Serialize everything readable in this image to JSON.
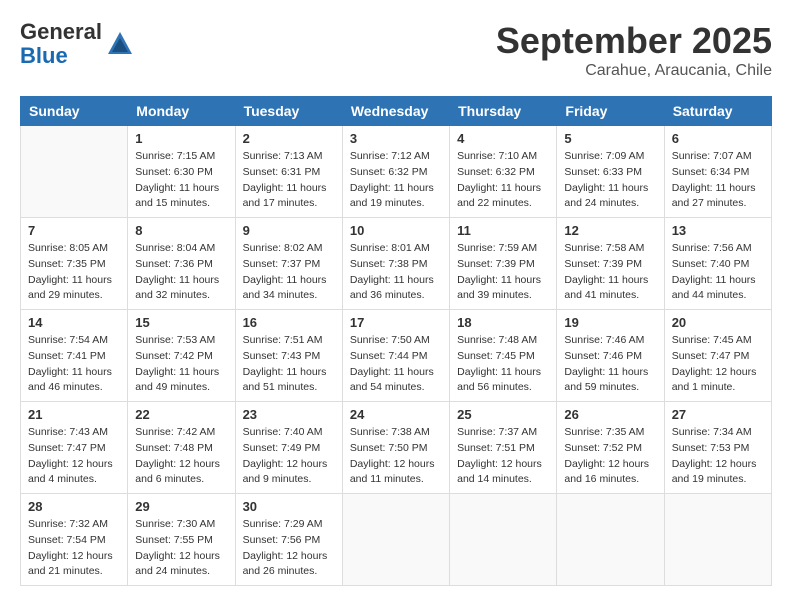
{
  "logo": {
    "general": "General",
    "blue": "Blue"
  },
  "title": {
    "month": "September 2025",
    "location": "Carahue, Araucania, Chile"
  },
  "weekdays": [
    "Sunday",
    "Monday",
    "Tuesday",
    "Wednesday",
    "Thursday",
    "Friday",
    "Saturday"
  ],
  "weeks": [
    [
      {
        "day": "",
        "info": ""
      },
      {
        "day": "1",
        "info": "Sunrise: 7:15 AM\nSunset: 6:30 PM\nDaylight: 11 hours\nand 15 minutes."
      },
      {
        "day": "2",
        "info": "Sunrise: 7:13 AM\nSunset: 6:31 PM\nDaylight: 11 hours\nand 17 minutes."
      },
      {
        "day": "3",
        "info": "Sunrise: 7:12 AM\nSunset: 6:32 PM\nDaylight: 11 hours\nand 19 minutes."
      },
      {
        "day": "4",
        "info": "Sunrise: 7:10 AM\nSunset: 6:32 PM\nDaylight: 11 hours\nand 22 minutes."
      },
      {
        "day": "5",
        "info": "Sunrise: 7:09 AM\nSunset: 6:33 PM\nDaylight: 11 hours\nand 24 minutes."
      },
      {
        "day": "6",
        "info": "Sunrise: 7:07 AM\nSunset: 6:34 PM\nDaylight: 11 hours\nand 27 minutes."
      }
    ],
    [
      {
        "day": "7",
        "info": "Sunrise: 8:05 AM\nSunset: 7:35 PM\nDaylight: 11 hours\nand 29 minutes."
      },
      {
        "day": "8",
        "info": "Sunrise: 8:04 AM\nSunset: 7:36 PM\nDaylight: 11 hours\nand 32 minutes."
      },
      {
        "day": "9",
        "info": "Sunrise: 8:02 AM\nSunset: 7:37 PM\nDaylight: 11 hours\nand 34 minutes."
      },
      {
        "day": "10",
        "info": "Sunrise: 8:01 AM\nSunset: 7:38 PM\nDaylight: 11 hours\nand 36 minutes."
      },
      {
        "day": "11",
        "info": "Sunrise: 7:59 AM\nSunset: 7:39 PM\nDaylight: 11 hours\nand 39 minutes."
      },
      {
        "day": "12",
        "info": "Sunrise: 7:58 AM\nSunset: 7:39 PM\nDaylight: 11 hours\nand 41 minutes."
      },
      {
        "day": "13",
        "info": "Sunrise: 7:56 AM\nSunset: 7:40 PM\nDaylight: 11 hours\nand 44 minutes."
      }
    ],
    [
      {
        "day": "14",
        "info": "Sunrise: 7:54 AM\nSunset: 7:41 PM\nDaylight: 11 hours\nand 46 minutes."
      },
      {
        "day": "15",
        "info": "Sunrise: 7:53 AM\nSunset: 7:42 PM\nDaylight: 11 hours\nand 49 minutes."
      },
      {
        "day": "16",
        "info": "Sunrise: 7:51 AM\nSunset: 7:43 PM\nDaylight: 11 hours\nand 51 minutes."
      },
      {
        "day": "17",
        "info": "Sunrise: 7:50 AM\nSunset: 7:44 PM\nDaylight: 11 hours\nand 54 minutes."
      },
      {
        "day": "18",
        "info": "Sunrise: 7:48 AM\nSunset: 7:45 PM\nDaylight: 11 hours\nand 56 minutes."
      },
      {
        "day": "19",
        "info": "Sunrise: 7:46 AM\nSunset: 7:46 PM\nDaylight: 11 hours\nand 59 minutes."
      },
      {
        "day": "20",
        "info": "Sunrise: 7:45 AM\nSunset: 7:47 PM\nDaylight: 12 hours\nand 1 minute."
      }
    ],
    [
      {
        "day": "21",
        "info": "Sunrise: 7:43 AM\nSunset: 7:47 PM\nDaylight: 12 hours\nand 4 minutes."
      },
      {
        "day": "22",
        "info": "Sunrise: 7:42 AM\nSunset: 7:48 PM\nDaylight: 12 hours\nand 6 minutes."
      },
      {
        "day": "23",
        "info": "Sunrise: 7:40 AM\nSunset: 7:49 PM\nDaylight: 12 hours\nand 9 minutes."
      },
      {
        "day": "24",
        "info": "Sunrise: 7:38 AM\nSunset: 7:50 PM\nDaylight: 12 hours\nand 11 minutes."
      },
      {
        "day": "25",
        "info": "Sunrise: 7:37 AM\nSunset: 7:51 PM\nDaylight: 12 hours\nand 14 minutes."
      },
      {
        "day": "26",
        "info": "Sunrise: 7:35 AM\nSunset: 7:52 PM\nDaylight: 12 hours\nand 16 minutes."
      },
      {
        "day": "27",
        "info": "Sunrise: 7:34 AM\nSunset: 7:53 PM\nDaylight: 12 hours\nand 19 minutes."
      }
    ],
    [
      {
        "day": "28",
        "info": "Sunrise: 7:32 AM\nSunset: 7:54 PM\nDaylight: 12 hours\nand 21 minutes."
      },
      {
        "day": "29",
        "info": "Sunrise: 7:30 AM\nSunset: 7:55 PM\nDaylight: 12 hours\nand 24 minutes."
      },
      {
        "day": "30",
        "info": "Sunrise: 7:29 AM\nSunset: 7:56 PM\nDaylight: 12 hours\nand 26 minutes."
      },
      {
        "day": "",
        "info": ""
      },
      {
        "day": "",
        "info": ""
      },
      {
        "day": "",
        "info": ""
      },
      {
        "day": "",
        "info": ""
      }
    ]
  ]
}
